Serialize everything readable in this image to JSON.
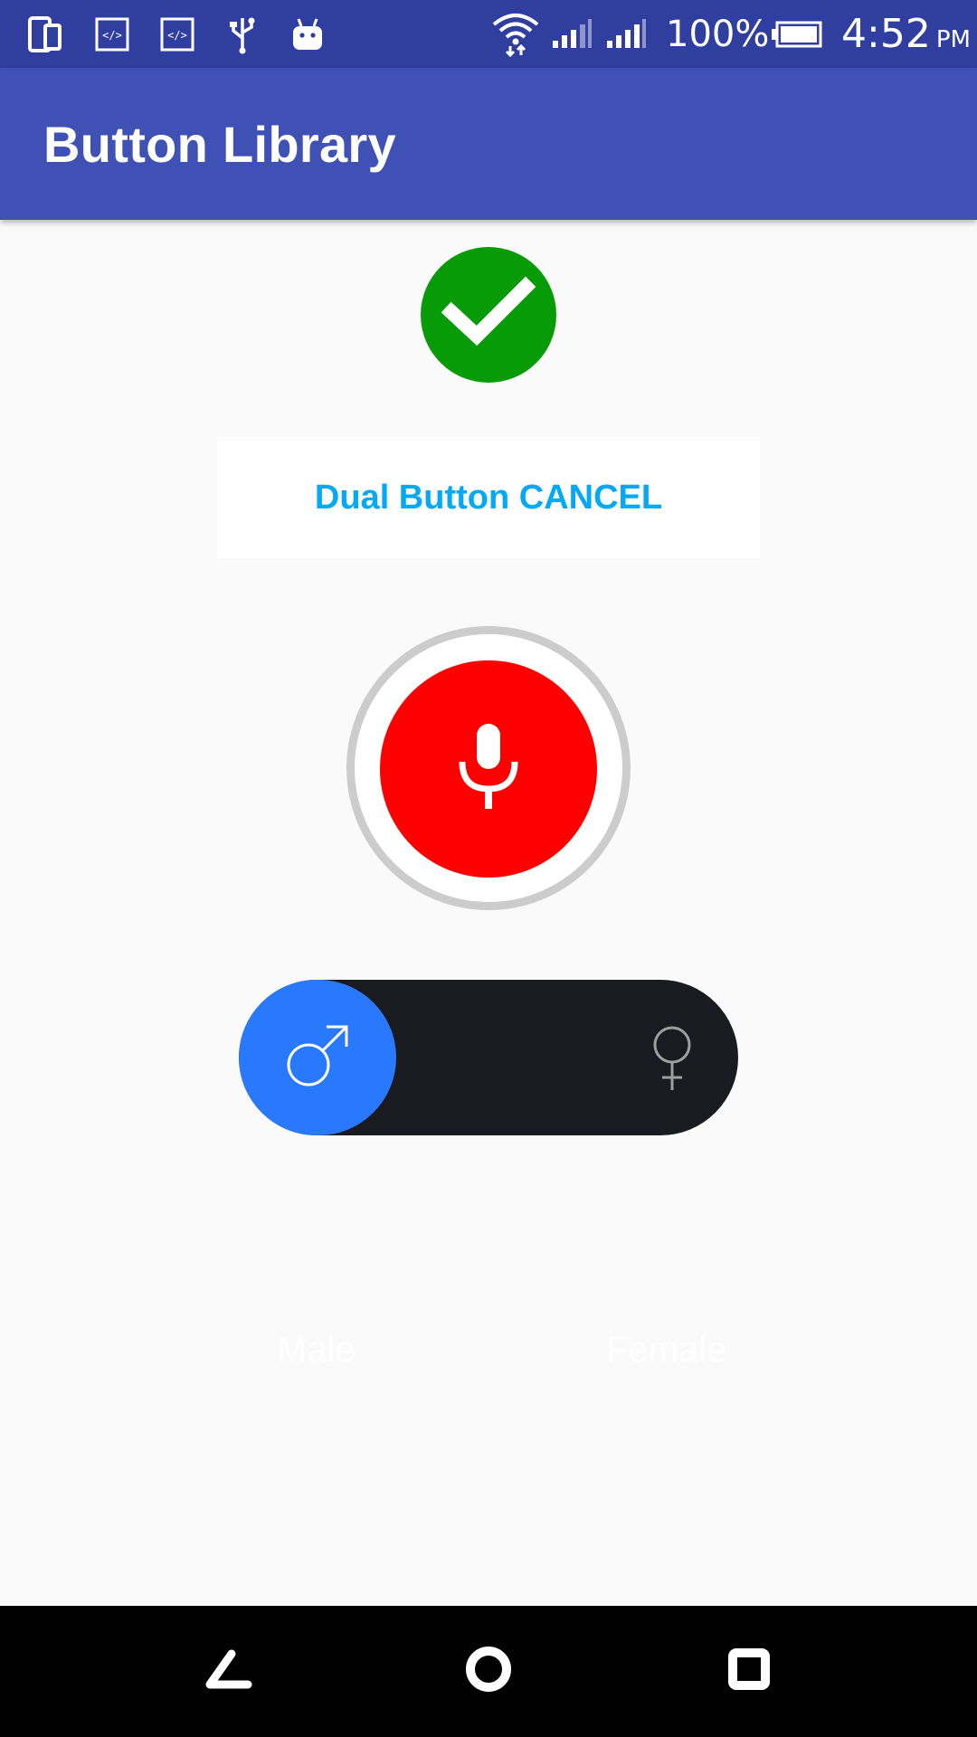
{
  "status_bar": {
    "icons": [
      "phone-tablet-icon",
      "code-icon",
      "code-icon",
      "usb-icon",
      "android-icon",
      "wifi-icon",
      "signal-icon",
      "signal-icon",
      "battery-icon"
    ],
    "battery_percent": "100%",
    "time": "4:52",
    "ampm": "PM"
  },
  "app_bar": {
    "title": "Button Library"
  },
  "main": {
    "check_button": {
      "icon": "checkmark-icon",
      "color": "#079b07"
    },
    "dual_button": {
      "label": "Dual Button CANCEL",
      "text_color": "#03a9f4"
    },
    "mic_button": {
      "icon": "microphone-icon",
      "color": "#ff0000"
    },
    "gender_toggle": {
      "selected": "male",
      "male_icon": "male-symbol-icon",
      "female_icon": "female-symbol-icon",
      "knob_color": "#2979ff",
      "track_color": "#1a1b20"
    },
    "labels": {
      "male": "Male",
      "female": "Female"
    }
  },
  "nav_bar": {
    "buttons": [
      "back-icon",
      "home-icon",
      "recents-icon"
    ]
  }
}
